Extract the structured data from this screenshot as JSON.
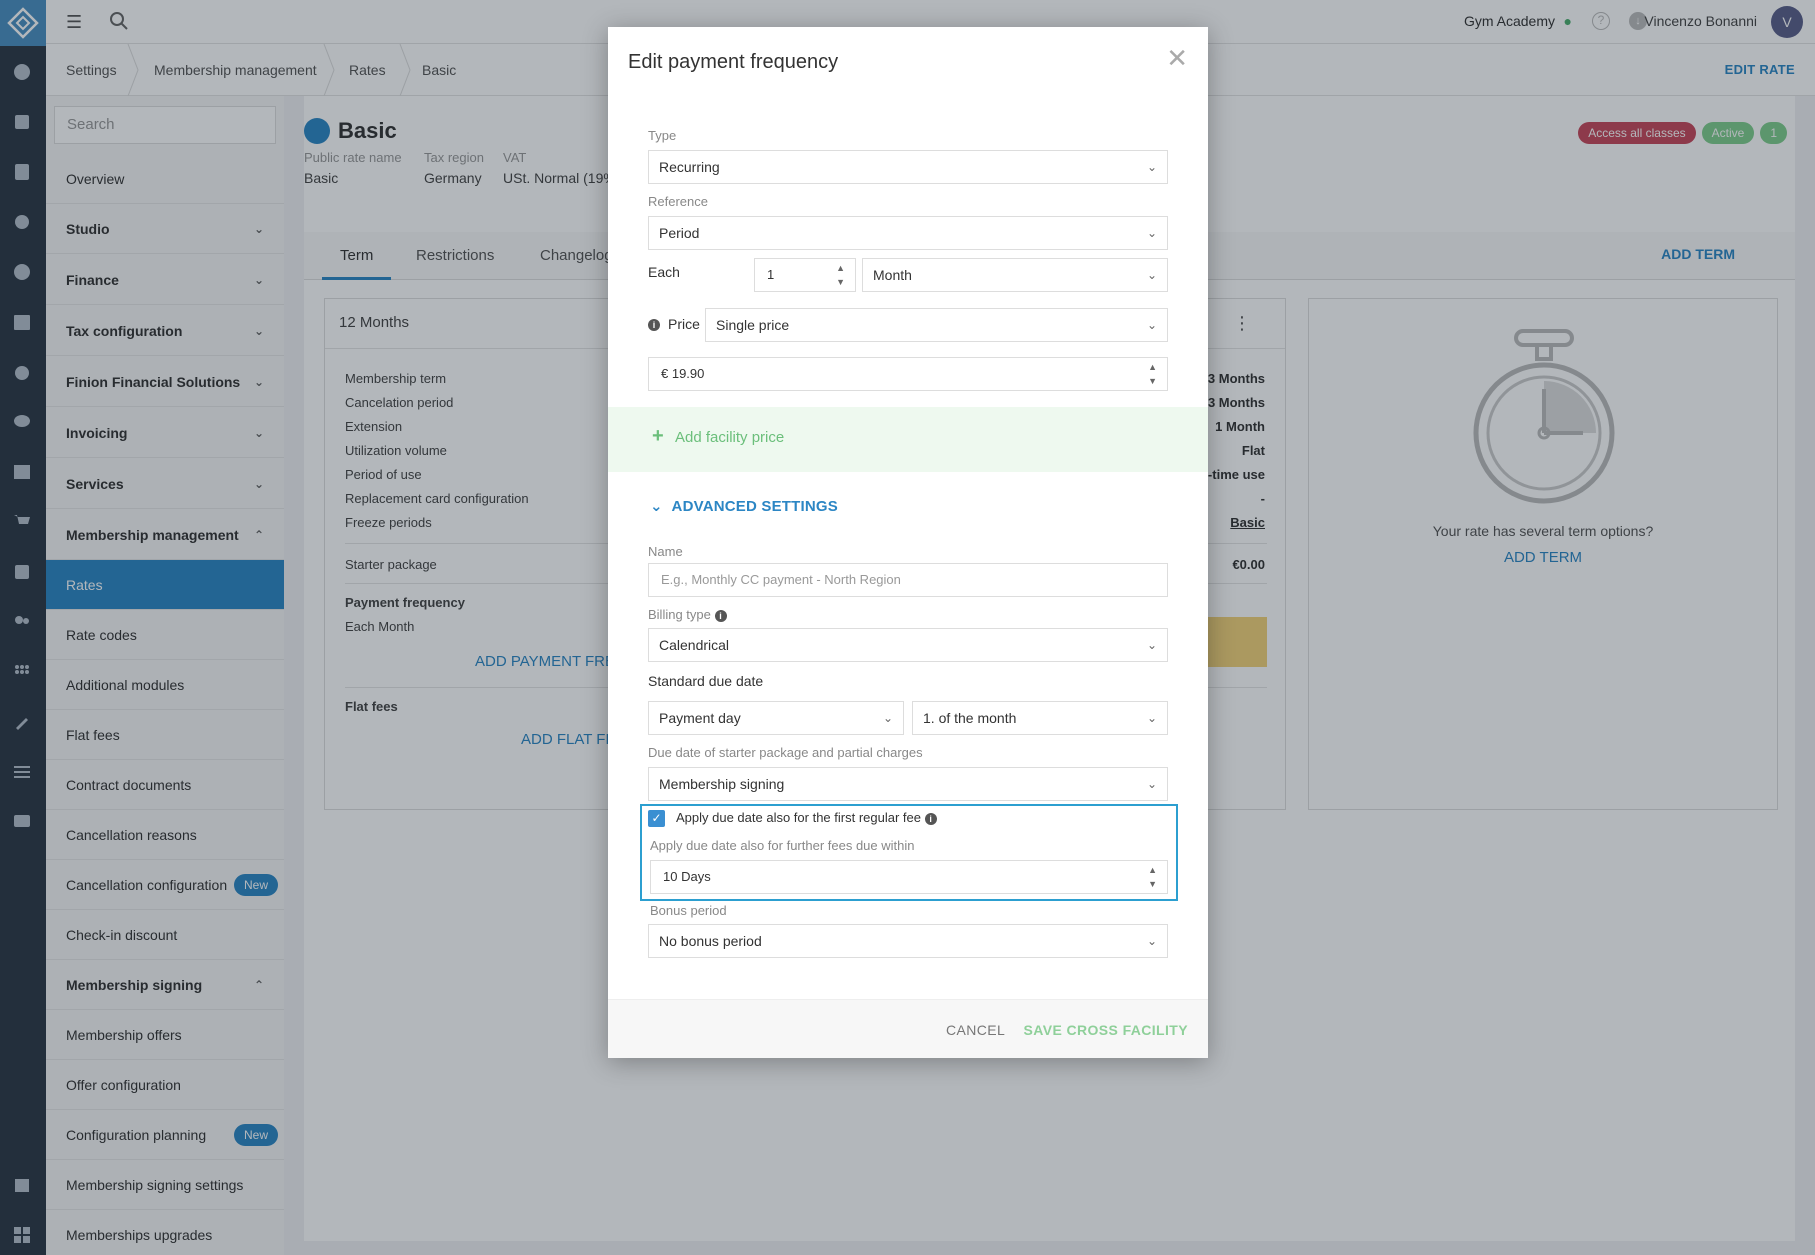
{
  "topbar": {
    "gym_name": "Gym Academy",
    "user_name": "Vincenzo Bonanni",
    "avatar_initial": "V"
  },
  "breadcrumbs": [
    "Settings",
    "Membership management",
    "Rates",
    "Basic"
  ],
  "edit_rate_label": "EDIT RATE",
  "sidebar": {
    "search_placeholder": "Search",
    "items": [
      {
        "label": "Overview",
        "type": "link"
      },
      {
        "label": "Studio",
        "type": "group",
        "expanded": false
      },
      {
        "label": "Finance",
        "type": "group",
        "expanded": false
      },
      {
        "label": "Tax configuration",
        "type": "group",
        "expanded": false
      },
      {
        "label": "Finion Financial Solutions",
        "type": "group",
        "expanded": false
      },
      {
        "label": "Invoicing",
        "type": "group",
        "expanded": false
      },
      {
        "label": "Services",
        "type": "group",
        "expanded": false
      },
      {
        "label": "Membership management",
        "type": "group",
        "expanded": true
      },
      {
        "label": "Rates",
        "type": "link",
        "active": true
      },
      {
        "label": "Rate codes",
        "type": "link"
      },
      {
        "label": "Additional modules",
        "type": "link"
      },
      {
        "label": "Flat fees",
        "type": "link"
      },
      {
        "label": "Contract documents",
        "type": "link"
      },
      {
        "label": "Cancellation reasons",
        "type": "link"
      },
      {
        "label": "Cancellation configuration",
        "type": "link",
        "badge": "New"
      },
      {
        "label": "Check-in discount",
        "type": "link"
      },
      {
        "label": "Membership signing",
        "type": "group",
        "expanded": true
      },
      {
        "label": "Membership offers",
        "type": "link"
      },
      {
        "label": "Offer configuration",
        "type": "link"
      },
      {
        "label": "Configuration planning",
        "type": "link",
        "badge": "New"
      },
      {
        "label": "Membership signing settings",
        "type": "link"
      },
      {
        "label": "Memberships upgrades",
        "type": "link"
      }
    ]
  },
  "rate": {
    "title": "Basic",
    "meta_labels": [
      "Public rate name",
      "Tax region",
      "VAT"
    ],
    "meta_values": [
      "Basic",
      "Germany",
      "USt. Normal (19%"
    ],
    "tags": [
      {
        "label": "Access all classes",
        "color": "#c8485a"
      },
      {
        "label": "Active",
        "color": "#7fcf8c"
      },
      {
        "label": "1",
        "color": "#7fcf8c"
      }
    ],
    "tabs": [
      "Term",
      "Restrictions",
      "Changelog"
    ],
    "add_term_label": "ADD TERM",
    "card_title": "12 Months",
    "rows": [
      {
        "label": "Membership term",
        "value": "13 Months"
      },
      {
        "label": "Cancelation period",
        "value": "3 Months"
      },
      {
        "label": "Extension",
        "value": "1 Month"
      },
      {
        "label": "Utilization volume",
        "value": "Flat"
      },
      {
        "label": "Period of use",
        "value": "e-time use"
      },
      {
        "label": "Replacement card configuration",
        "value": "-"
      },
      {
        "label": "Freeze periods",
        "value": "Basic"
      }
    ],
    "starter_package_label": "Starter package",
    "starter_package_value": "€0.00",
    "payment_frequency_label": "Payment frequency",
    "payment_frequency_value": "Each Month",
    "add_payment_label": "ADD PAYMENT FREQ",
    "flat_fees_label": "Flat fees",
    "add_flat_label": "ADD FLAT FE",
    "side_text": "Your rate has several term options?",
    "side_add_term": "ADD TERM"
  },
  "modal": {
    "title": "Edit payment frequency",
    "type_label": "Type",
    "type_value": "Recurring",
    "reference_label": "Reference",
    "reference_value": "Period",
    "each_label": "Each",
    "each_value": "1",
    "each_unit": "Month",
    "price_label": "Price",
    "price_mode": "Single price",
    "price_value": "€ 19.90",
    "add_facility_label": "Add facility price",
    "advanced_label": "ADVANCED SETTINGS",
    "name_label": "Name",
    "name_placeholder": "E.g., Monthly CC payment - North Region",
    "billing_type_label": "Billing type",
    "billing_type_value": "Calendrical",
    "due_date_label": "Standard due date",
    "due_date_mode": "Payment day",
    "due_date_day": "1. of the month",
    "starter_due_label": "Due date of starter package and partial charges",
    "starter_due_value": "Membership signing",
    "apply_checkbox_label": "Apply due date also for the first regular fee",
    "apply_checked": true,
    "further_label": "Apply due date also for further fees due within",
    "further_value": "10 Days",
    "bonus_label": "Bonus period",
    "bonus_value": "No bonus period",
    "cancel_label": "CANCEL",
    "save_label": "SAVE CROSS FACILITY"
  }
}
